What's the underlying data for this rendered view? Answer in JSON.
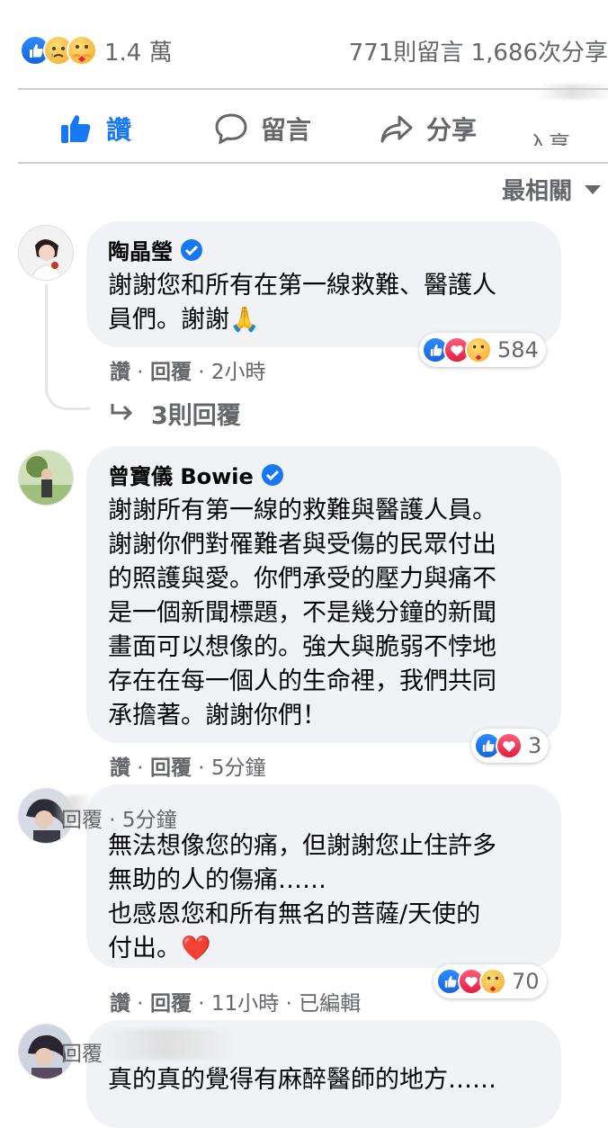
{
  "stats": {
    "reaction_count": "1.4 萬",
    "comments_shares": "771則留言 1,686次分享"
  },
  "actions": {
    "like": "讚",
    "comment": "留言",
    "share": "分享",
    "partial": "入享"
  },
  "sort": {
    "label": "最相關"
  },
  "comments": [
    {
      "author": "陶晶瑩",
      "text": "謝謝您和所有在第一線救難、醫護人\n員們。謝謝🙏",
      "like": "讚",
      "reply": "回覆",
      "time": "2小時",
      "reaction_count": "584",
      "replies_label": "3則回覆"
    },
    {
      "author": "曾寶儀 Bowie",
      "text": "謝謝所有第一線的救難與醫護人員。\n謝謝你們對罹難者與受傷的民眾付出\n的照護與愛。你們承受的壓力與痛不\n是一個新聞標題，不是幾分鐘的新聞\n畫面可以想像的。強大與脆弱不悖地\n存在在每一個人的生命裡，我們共同\n承擔著。謝謝你們！",
      "like": "讚",
      "reply": "回覆",
      "time": "5分鐘",
      "reaction_count": "3"
    },
    {
      "header": "回覆 · 5分鐘",
      "text": "無法想像您的痛，但謝謝您止住許多\n無助的人的傷痛……\n也感恩您和所有無名的菩薩/天使的\n付出。❤️",
      "like": "讚",
      "reply": "回覆",
      "time": "11小時",
      "edited": "已編輯",
      "reaction_count": "70"
    },
    {
      "header": "回覆",
      "text": "真的真的覺得有麻醉醫師的地方……"
    }
  ],
  "colors": {
    "accent": "#1877f2",
    "muted": "#65676b",
    "bubble": "#f0f2f5",
    "love": "#e41e3f"
  }
}
